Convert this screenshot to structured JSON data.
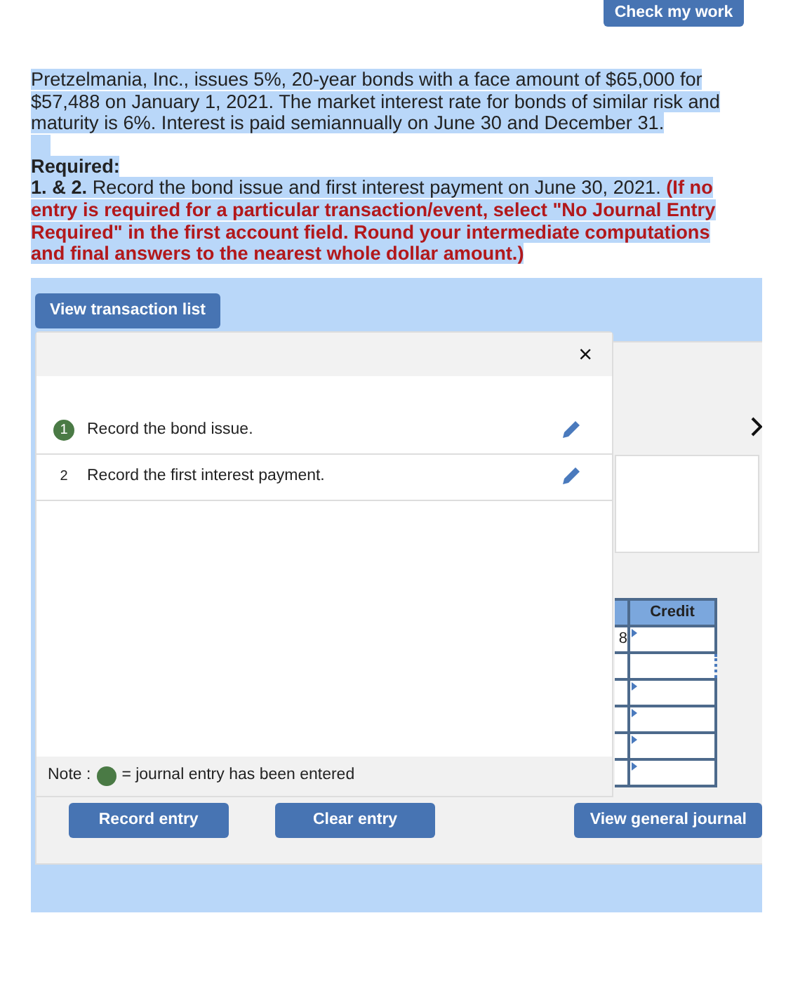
{
  "header": {
    "check_button": "Check my work"
  },
  "problem": {
    "text": "Pretzelmania, Inc., issues 5%, 20-year bonds with a face amount of $65,000 for $57,488 on January 1, 2021. The market interest rate for bonds of similar risk and maturity is 6%. Interest is paid semiannually on June 30 and December 31.",
    "required_label": "Required:",
    "instruction_lead": "1. & 2.",
    "instruction": "Record the bond issue and first interest payment on June 30, 2021.",
    "instruction_note": "(If no entry is required for a particular transaction/event, select \"No Journal Entry Required\" in the first account field. Round your intermediate computations and final answers to the nearest whole dollar amount.)"
  },
  "transaction_list": {
    "button": "View transaction list",
    "close": "×",
    "items": [
      {
        "number": "1",
        "text": "Record the bond issue.",
        "entered": true
      },
      {
        "number": "2",
        "text": "Record the first interest payment.",
        "entered": false
      }
    ],
    "note": {
      "label": "Note :",
      "text": "= journal entry has been entered"
    }
  },
  "journal": {
    "column": "Credit",
    "rows": [
      {
        "debit": "8",
        "focused": false
      },
      {
        "focused": true
      },
      {
        "focused": false
      },
      {
        "focused": false
      },
      {
        "focused": false
      },
      {
        "focused": false
      }
    ]
  },
  "buttons": [
    "Record entry",
    "Clear entry",
    "View general journal"
  ]
}
